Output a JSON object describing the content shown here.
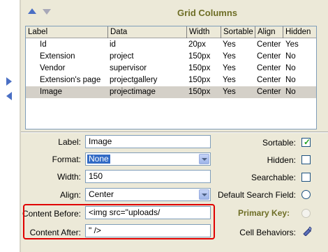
{
  "header": {
    "title": "Grid Columns"
  },
  "grid": {
    "columns": [
      "Label",
      "Data",
      "Width",
      "Sortable",
      "Align",
      "Hidden"
    ],
    "rows": [
      [
        "Id",
        "id",
        "20px",
        "Yes",
        "Center",
        "Yes"
      ],
      [
        "Extension",
        "project",
        "150px",
        "Yes",
        "Center",
        "No"
      ],
      [
        "Vendor",
        "supervisor",
        "150px",
        "Yes",
        "Center",
        "No"
      ],
      [
        "Extension's page",
        "projectgallery",
        "150px",
        "Yes",
        "Center",
        "No"
      ],
      [
        "Image",
        "projectimage",
        "150px",
        "Yes",
        "Center",
        "No"
      ]
    ],
    "selected_row": 4
  },
  "form": {
    "label": {
      "caption": "Label:",
      "value": "Image"
    },
    "format": {
      "caption": "Format:",
      "value": "None"
    },
    "width": {
      "caption": "Width:",
      "value": "150"
    },
    "align": {
      "caption": "Align:",
      "value": "Center"
    },
    "content_before": {
      "caption": "Content Before:",
      "value": "<img src=\"uploads/"
    },
    "content_after": {
      "caption": "Content After:",
      "value": "\" />"
    },
    "sortable": {
      "caption": "Sortable:",
      "checked": true
    },
    "hidden": {
      "caption": "Hidden:",
      "checked": false
    },
    "searchable": {
      "caption": "Searchable:",
      "checked": false
    },
    "default_search": {
      "caption": "Default Search Field:",
      "checked": false
    },
    "primary_key": {
      "caption": "Primary Key:",
      "checked": false
    },
    "cell_behaviors": {
      "caption": "Cell Behaviors:"
    }
  },
  "colors": {
    "accent": "#4a6fc4",
    "title": "#6e6e26",
    "highlight": "#e00000"
  }
}
